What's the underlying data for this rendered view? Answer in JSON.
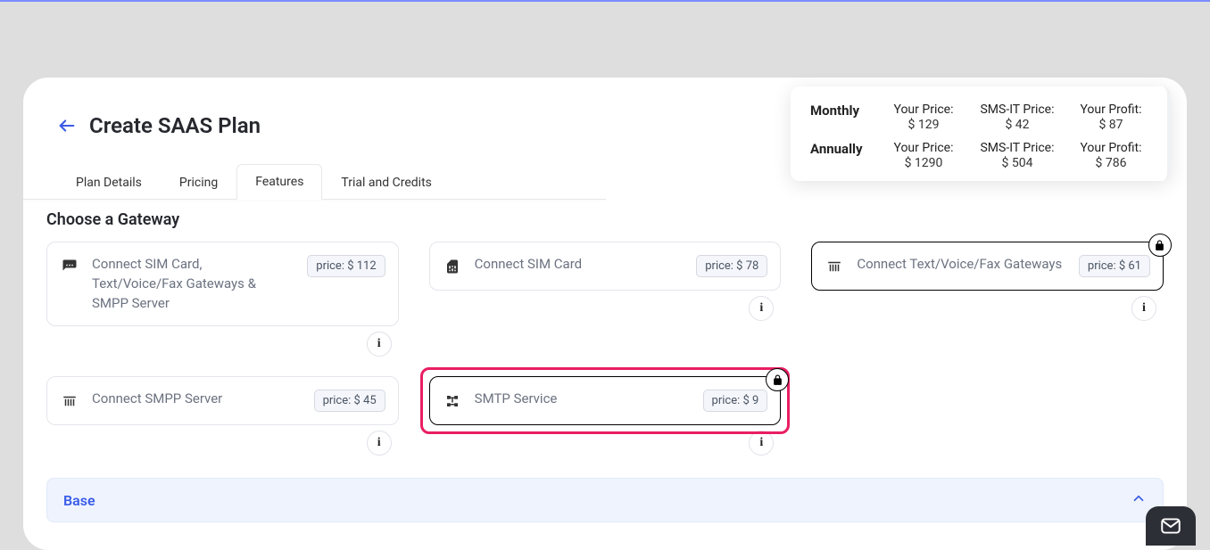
{
  "header": {
    "title": "Create SAAS Plan"
  },
  "tabs": [
    {
      "label": "Plan Details",
      "active": false
    },
    {
      "label": "Pricing",
      "active": false
    },
    {
      "label": "Features",
      "active": true
    },
    {
      "label": "Trial and Credits",
      "active": false
    }
  ],
  "section_title": "Choose a Gateway",
  "gateways": [
    {
      "icon": "chat-icon",
      "label": "Connect SIM Card, Text/Voice/Fax Gateways & SMPP Server",
      "price": "price: $ 112",
      "selected": false,
      "locked": false,
      "highlighted": false
    },
    {
      "icon": "sim-icon",
      "label": "Connect SIM Card",
      "price": "price: $ 78",
      "selected": false,
      "locked": false,
      "highlighted": false
    },
    {
      "icon": "gate-icon",
      "label": "Connect Text/Voice/Fax Gateways",
      "price": "price: $ 61",
      "selected": true,
      "locked": true,
      "highlighted": false
    },
    {
      "icon": "gate-icon",
      "label": "Connect SMPP Server",
      "price": "price: $ 45",
      "selected": false,
      "locked": false,
      "highlighted": false
    },
    {
      "icon": "tree-icon",
      "label": "SMTP Service",
      "price": "price: $ 9",
      "selected": true,
      "locked": true,
      "highlighted": true
    }
  ],
  "accordion": {
    "title": "Base"
  },
  "summary": {
    "monthly": {
      "period": "Monthly",
      "your_price_label": "Your Price:",
      "your_price": "$ 129",
      "smsit_label": "SMS-IT Price:",
      "smsit_price": "$ 42",
      "profit_label": "Your Profit:",
      "profit": "$ 87"
    },
    "annually": {
      "period": "Annually",
      "your_price_label": "Your Price:",
      "your_price": "$ 1290",
      "smsit_label": "SMS-IT Price:",
      "smsit_price": "$ 504",
      "profit_label": "Your Profit:",
      "profit": "$ 786"
    }
  },
  "info_char": "i"
}
